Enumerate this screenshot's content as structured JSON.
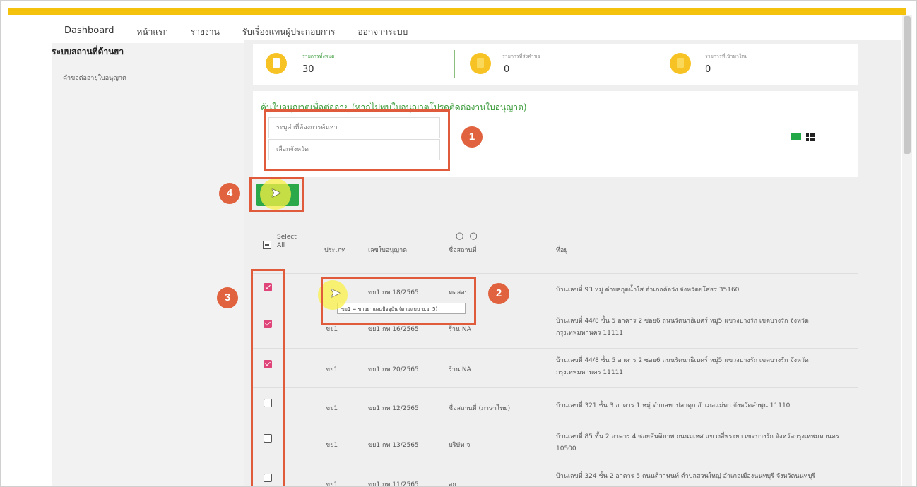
{
  "nav": {
    "items": [
      "Dashboard",
      "หน้าแรก",
      "รายงาน",
      "รับเรื่องแทนผู้ประกอบการ",
      "ออกจากระบบ"
    ]
  },
  "sidebar": {
    "title": "ระบบสถานที่ด้านยา",
    "link": "คำขอต่ออายุใบอนุญาต"
  },
  "stats": [
    {
      "label": "รายการทั้งหมด",
      "value": "30",
      "label_color": "#3a9b3a"
    },
    {
      "label": "รายการที่ส่งคำขอ",
      "value": "0",
      "label_color": "#888888"
    },
    {
      "label": "รายการที่เข้ามาใหม่",
      "value": "0",
      "label_color": "#888888"
    }
  ],
  "search": {
    "heading": "ค้นใบอนุญาตเพื่อต่ออายุ (หากไม่พบใบอนุญาตโปรดติดต่องานใบอนุญาต)",
    "keyword_placeholder": "ระบุคำที่ต้องการค้นหา",
    "province_placeholder": "เลือกจังหวัด"
  },
  "table": {
    "headers": {
      "select_all": "Select",
      "select_all_sub": "All",
      "type": "ประเภท",
      "license_no": "เลขใบอนุญาต",
      "place_name": "ชื่อสถานที่",
      "address": "ที่อยู่",
      "sort_marks": "○ ○"
    },
    "rows": [
      {
        "checked": true,
        "type": "",
        "license": "ขย1 กท 18/2565",
        "name": "ทดสอบ",
        "address": "บ้านเลขที่ 93 หมู่ ตำบลกุดน้ำใส อำเภอค้อวัง จังหวัดยโสธร 35160"
      },
      {
        "checked": true,
        "type": "ขย1",
        "license": "ขย1 กท 16/2565",
        "name": "ร้าน NA",
        "address": "บ้านเลขที่ 44/8 ชั้น 5 อาคาร 2 ซอย6 ถนนรัตนาธิเบศร์ หมู่5 แขวงบางรัก เขตบางรัก จังหวัดกรุงเทพมหานคร 11111"
      },
      {
        "checked": true,
        "type": "ขย1",
        "license": "ขย1 กท 20/2565",
        "name": "ร้าน NA",
        "address": "บ้านเลขที่ 44/8 ชั้น 5 อาคาร 2 ซอย6 ถนนรัตนาธิเบศร์ หมู่5 แขวงบางรัก เขตบางรัก จังหวัดกรุงเทพมหานคร 11111"
      },
      {
        "checked": false,
        "type": "ขย1",
        "license": "ขย1 กท 12/2565",
        "name": "ชื่อสถานที่ (ภาษาไทย)",
        "address": "บ้านเลขที่ 321 ชั้น 3 อาคาร 1 หมู่ ตำบลทาปลาดุก อำเภอแม่ทา จังหวัดลำพูน 11110"
      },
      {
        "checked": false,
        "type": "ขย1",
        "license": "ขย1 กท 13/2565",
        "name": "บริษัท จ",
        "address": "บ้านเลขที่ 85 ชั้น 2 อาคาร 4 ซอยสันติภาพ ถนนมเหศ แขวงสี่พระยา เขตบางรัก จังหวัดกรุงเทพมหานคร 10500"
      },
      {
        "checked": false,
        "type": "ขย1",
        "license": "ขย1 กท 11/2565",
        "name": "อย",
        "address": "บ้านเลขที่ 324 ชั้น 2 อาคาร 5 ถนนติวานนท์ ตำบลสวนใหญ่ อำเภอเมืองนนทบุรี จังหวัดนนทบุรี"
      }
    ]
  },
  "tooltip": "ขย1 = ขายยาแผนปัจจุบัน (ตามแบบ ข.ย. 5)",
  "annotations": {
    "badge_1": "1",
    "badge_2": "2",
    "badge_3": "3",
    "badge_4": "4"
  },
  "colors": {
    "top_bar": "#f4c20d",
    "accent_green": "#2aa84a",
    "annotation_red": "#e05a3c",
    "checkbox_pink": "#e0457a"
  },
  "icons": {
    "stat_icon": "document-icon",
    "cursor": "mouse-pointer-icon",
    "view_list": "list-view-icon",
    "view_grid": "grid-view-icon"
  }
}
